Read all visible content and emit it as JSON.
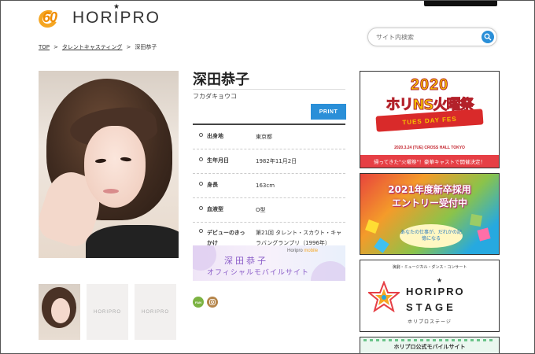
{
  "header": {
    "logo_number": "60",
    "logo_text": "HORIPRO",
    "search_placeholder": "サイト内検索"
  },
  "breadcrumb": {
    "top": "TOP",
    "category": "タレントキャスティング",
    "current": "深田恭子"
  },
  "talent": {
    "name": "深田恭子",
    "kana": "フカダキョウコ",
    "print_label": "PRINT",
    "profile": [
      {
        "label": "出身地",
        "value": "東京都"
      },
      {
        "label": "生年月日",
        "value": "1982年11月2日"
      },
      {
        "label": "身長",
        "value": "163cm"
      },
      {
        "label": "血液型",
        "value": "O型"
      },
      {
        "label": "デビューのきっかけ",
        "value": "第21回 タレント・スカウト・キャラバングランプリ（1996年）"
      }
    ],
    "thumbs": [
      "HORIPRO",
      "HORIPRO"
    ],
    "mobile_banner": {
      "tag_a": "Horipro",
      "tag_b": "mobile",
      "name": "深田恭子",
      "subtitle": "オフィシャルモバイルサイト"
    },
    "social": {
      "fan": "FAN"
    }
  },
  "sidebar": {
    "ad1": {
      "year": "2020",
      "title": "ホリNS火曜祭",
      "ribbon": "TUES DAY FES",
      "date": "2020.3.24 (TUE) CROSS HALL TOKYO",
      "bottom": "帰ってきた\"火曜祭\"！豪華キャストで開催決定！"
    },
    "ad2": {
      "line1": "2021年度新卒採用",
      "line2": "エントリー受付中",
      "bubble": "あなたの仕事が、だれかの記憶になる"
    },
    "ad3": {
      "topline": "演劇・ミュージカル・ダンス・コンサート",
      "hp": "HORIPRO",
      "stage": "STAGE",
      "jp": "ホリプロステージ"
    },
    "ad4": {
      "title": "ホリプロ公式モバイルサイト"
    }
  },
  "colors": {
    "accent_blue": "#2a8fd8",
    "logo_orange": "#f5a623",
    "banner_purple": "#8a5cc8"
  }
}
